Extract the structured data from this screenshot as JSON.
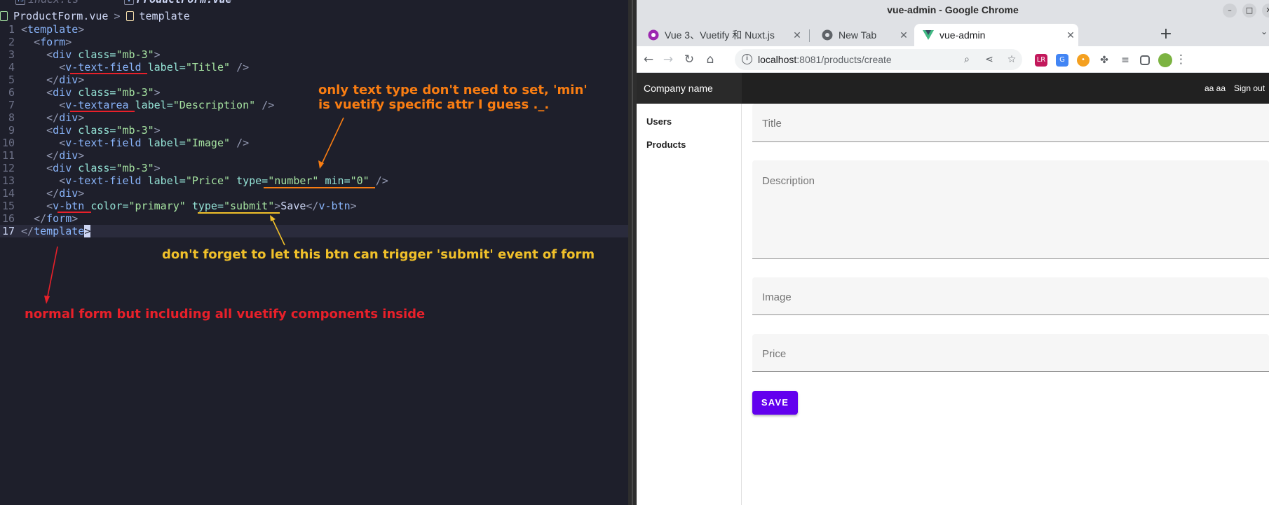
{
  "editor": {
    "tabs": [
      {
        "label": "index.ts",
        "active": false
      },
      {
        "label": "ProductForm.vue",
        "active": true
      }
    ],
    "breadcrumb": {
      "file": "ProductForm.vue",
      "separator": ">",
      "node": "template"
    },
    "lines": [
      {
        "num": "1"
      },
      {
        "num": "2"
      },
      {
        "num": "3"
      },
      {
        "num": "4"
      },
      {
        "num": "5"
      },
      {
        "num": "6"
      },
      {
        "num": "7"
      },
      {
        "num": "8"
      },
      {
        "num": "9"
      },
      {
        "num": "10"
      },
      {
        "num": "11"
      },
      {
        "num": "12"
      },
      {
        "num": "13"
      },
      {
        "num": "14"
      },
      {
        "num": "15"
      },
      {
        "num": "16"
      },
      {
        "num": "17"
      }
    ],
    "code": {
      "template": "template",
      "form": "form",
      "div": "div",
      "class_attr": "class=",
      "mb3": "\"mb-3\"",
      "v_text_field": "v-text-field",
      "v_textarea": "v-textarea",
      "v_btn": "v-btn",
      "label_attr": "label=",
      "title_val": "\"Title\"",
      "desc_val": "\"Description\"",
      "image_val": "\"Image\"",
      "price_val": "\"Price\"",
      "type_attr": "type=",
      "number_val": "\"number\"",
      "min_attr": "min=",
      "zero_val": "\"0\"",
      "color_attr": "color=",
      "primary_val": "\"primary\"",
      "submit_val": "\"submit\"",
      "save_text": "Save"
    },
    "annotations": {
      "orange_line1": "only text type don't need to set, 'min'",
      "orange_line2": "is vuetify specific attr I guess ._.",
      "yellow": "don't forget to let this btn can trigger 'submit' event of form",
      "red": "normal form but including all vuetify components inside"
    },
    "colors": {
      "red": "#e8202a",
      "orange": "#f97d12",
      "yellow": "#f0c02a"
    }
  },
  "chrome": {
    "window_title": "vue-admin - Google Chrome",
    "tabs": [
      {
        "label": "Vue 3、Vuetify 和 Nuxt.js",
        "icon": "vuetify-favicon"
      },
      {
        "label": "New Tab",
        "icon": "chrome-favicon"
      },
      {
        "label": "vue-admin",
        "icon": "vue-favicon"
      }
    ],
    "url_host": "localhost",
    "url_path": ":8081/products/create"
  },
  "app": {
    "brand": "Company name",
    "user": "aa aa",
    "sign_out": "Sign out",
    "nav": [
      {
        "label": "Users"
      },
      {
        "label": "Products"
      }
    ],
    "form": {
      "title_label": "Title",
      "description_label": "Description",
      "image_label": "Image",
      "price_label": "Price",
      "save_label": "SAVE"
    },
    "primary_color": "#6200ee"
  }
}
